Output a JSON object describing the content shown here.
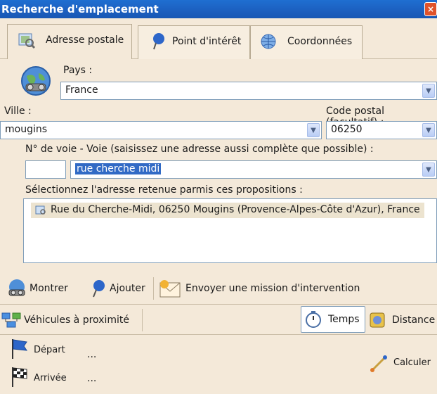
{
  "window": {
    "title": "Recherche d'emplacement",
    "close_label": "×"
  },
  "tabs": [
    {
      "label": "Adresse postale",
      "icon": "map-search-icon",
      "active": true
    },
    {
      "label": "Point d'intérêt",
      "icon": "pin-icon",
      "active": false
    },
    {
      "label": "Coordonnées",
      "icon": "globe-icon",
      "active": false
    }
  ],
  "form": {
    "country_label": "Pays :",
    "country_value": "France",
    "city_label": "Ville :",
    "city_value": "mougins",
    "postal_label": "Code postal (facultatif) :",
    "postal_value": "06250",
    "street_label": "N° de voie - Voie (saisissez une adresse aussi complète que possible) :",
    "street_number": "",
    "street_value": "rue cherche midi",
    "results_label": "Sélectionnez l'adresse retenue parmis ces propositions :",
    "results": [
      "Rue du Cherche-Midi, 06250 Mougins (Provence-Alpes-Côte d'Azur), France"
    ]
  },
  "actions": {
    "show": "Montrer",
    "add": "Ajouter",
    "send_mission": "Envoyer une mission d'intervention",
    "nearby_vehicles": "Véhicules à proximité",
    "time": "Temps",
    "distance": "Distance",
    "departure": "Départ",
    "departure_value": "...",
    "arrival": "Arrivée",
    "arrival_value": "...",
    "compute": "Calculer"
  },
  "colors": {
    "titlebar": "#1c5fbf",
    "panel_bg": "#f4e9d9",
    "selection": "#316ac5"
  }
}
